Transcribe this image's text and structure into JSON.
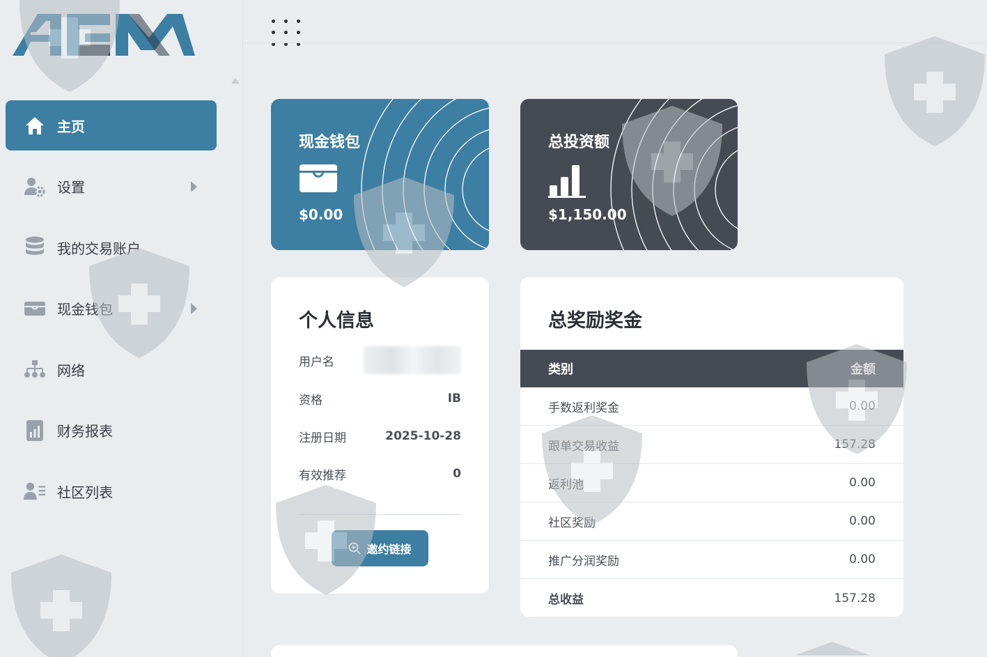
{
  "brand": {
    "logo_text": "ACM"
  },
  "sidebar": {
    "items": [
      {
        "label": "主页",
        "icon": "home-icon",
        "active": true
      },
      {
        "label": "设置",
        "icon": "user-gear-icon",
        "has_submenu": true
      },
      {
        "label": "我的交易账户",
        "icon": "database-icon"
      },
      {
        "label": "现金钱包",
        "icon": "wallet-icon",
        "has_submenu": true
      },
      {
        "label": "网络",
        "icon": "network-icon"
      },
      {
        "label": "财务报表",
        "icon": "report-chart-icon"
      },
      {
        "label": "社区列表",
        "icon": "user-list-icon"
      }
    ]
  },
  "cards": {
    "cash_wallet": {
      "title": "现金钱包",
      "value": "$0.00",
      "icon": "wallet-icon",
      "color": "#3d7ea3"
    },
    "total_investment": {
      "title": "总投资额",
      "value": "$1,150.00",
      "icon": "bar-chart-icon",
      "color": "#464b53"
    }
  },
  "profile": {
    "title": "个人信息",
    "rows": [
      {
        "label": "用户名",
        "value": ""
      },
      {
        "label": "资格",
        "value": "IB"
      },
      {
        "label": "注册日期",
        "value": "2025-10-28"
      },
      {
        "label": "有效推荐",
        "value": "0"
      }
    ],
    "invite_button": "邀约链接"
  },
  "bonus": {
    "title": "总奖励奖金",
    "columns": [
      "类别",
      "金额"
    ],
    "rows": [
      {
        "category": "手数返利奖金",
        "amount": "0.00"
      },
      {
        "category": "跟单交易收益",
        "amount": "157.28"
      },
      {
        "category": "返利池",
        "amount": "0.00"
      },
      {
        "category": "社区奖励",
        "amount": "0.00"
      },
      {
        "category": "推广分润奖励",
        "amount": "0.00"
      },
      {
        "category": "总收益",
        "amount": "157.28"
      }
    ]
  },
  "colors": {
    "accent": "#3d7ea3",
    "dark": "#464b53",
    "background": "#e9edf0"
  }
}
